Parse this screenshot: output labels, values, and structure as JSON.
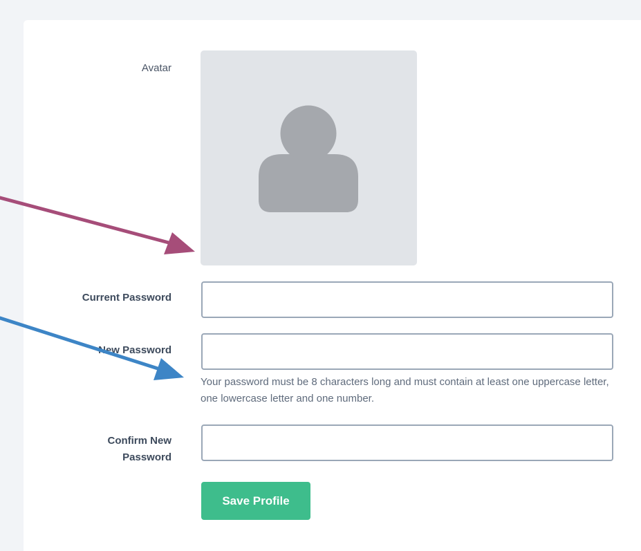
{
  "form": {
    "avatar_label": "Avatar",
    "current_password_label": "Current Password",
    "current_password_value": "",
    "new_password_label": "New Password",
    "new_password_value": "",
    "new_password_help": "Your password must be 8 characters long and must contain at least one uppercase letter, one lowercase letter and one number.",
    "confirm_password_label_line1": "Confirm New",
    "confirm_password_label_line2": "Password",
    "confirm_password_value": "",
    "save_label": "Save Profile"
  },
  "icons": {
    "avatar": "user-placeholder-icon"
  },
  "colors": {
    "page_background": "#f2f4f7",
    "card_background": "#ffffff",
    "avatar_background": "#e1e4e8",
    "avatar_silhouette": "#a5a8ad",
    "input_border": "#9aa7b7",
    "save_button": "#3ebd8c",
    "arrow_magenta": "#a64d79",
    "arrow_blue": "#3d85c6"
  }
}
